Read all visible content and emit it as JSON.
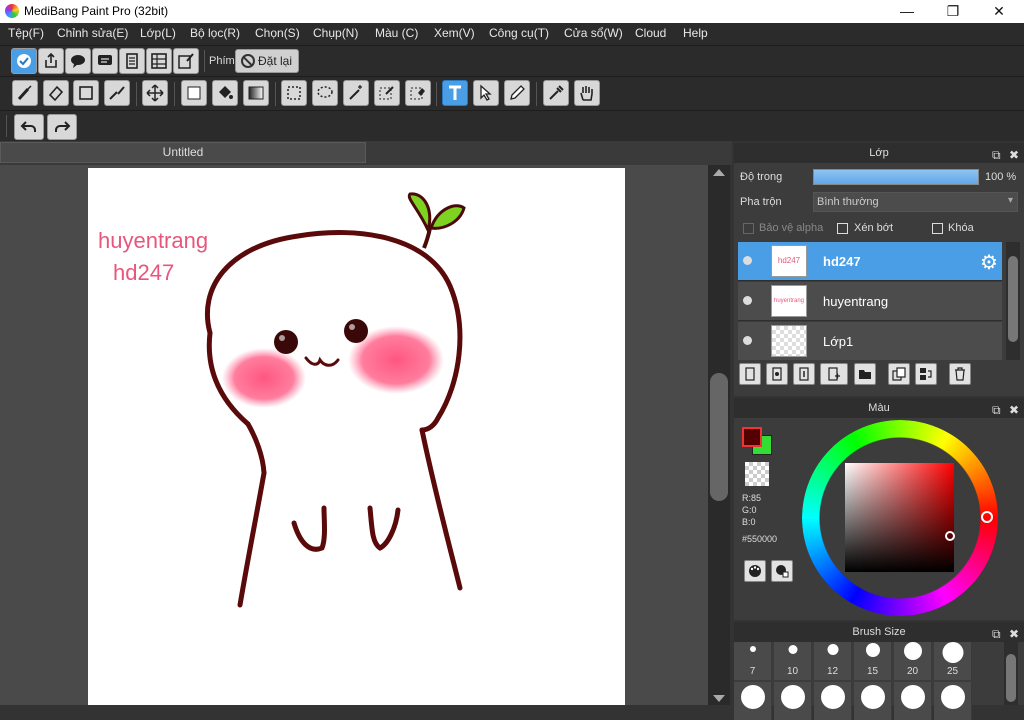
{
  "window": {
    "title": "MediBang Paint Pro (32bit)",
    "minimize": "—",
    "maximize": "❐",
    "close": "✕"
  },
  "menu": [
    "Tệp(F)",
    "Chỉnh sửa(E)",
    "Lớp(L)",
    "Bộ lọc(R)",
    "Chọn(S)",
    "Chụp(N)",
    "Màu (C)",
    "Xem(V)",
    "Công cụ(T)",
    "Cửa sổ(W)",
    "Cloud",
    "Help"
  ],
  "toolbar1": {
    "phim_label": "Phím",
    "reset_label": "Đặt lại"
  },
  "tab": {
    "label": "Untitled"
  },
  "canvas": {
    "text_line1": "huyentrang",
    "text_line2": "hd247"
  },
  "layer_panel": {
    "title": "Lớp",
    "opacity_label": "Độ trong",
    "opacity_value": "100 %",
    "opacity": 1.0,
    "blend_label": "Pha trộn",
    "blend_value": "Bình thường",
    "alpha_protect": "Bảo vệ alpha",
    "clipping": "Xén bớt",
    "lock": "Khóa",
    "layers": [
      {
        "name": "hd247",
        "thumb": "hd247",
        "selected": true
      },
      {
        "name": "huyentrang",
        "thumb": "huyentrang",
        "selected": false
      },
      {
        "name": "Lớp1",
        "thumb": "",
        "selected": false
      }
    ]
  },
  "color_panel": {
    "title": "Màu",
    "r": "R:85",
    "g": "G:0",
    "b": "B:0",
    "hex": "#550000",
    "primary": "#550000",
    "secondary": "#33dd33"
  },
  "brush_panel": {
    "title": "Brush Size",
    "sizes": [
      "7",
      "10",
      "12",
      "15",
      "20",
      "25"
    ]
  }
}
